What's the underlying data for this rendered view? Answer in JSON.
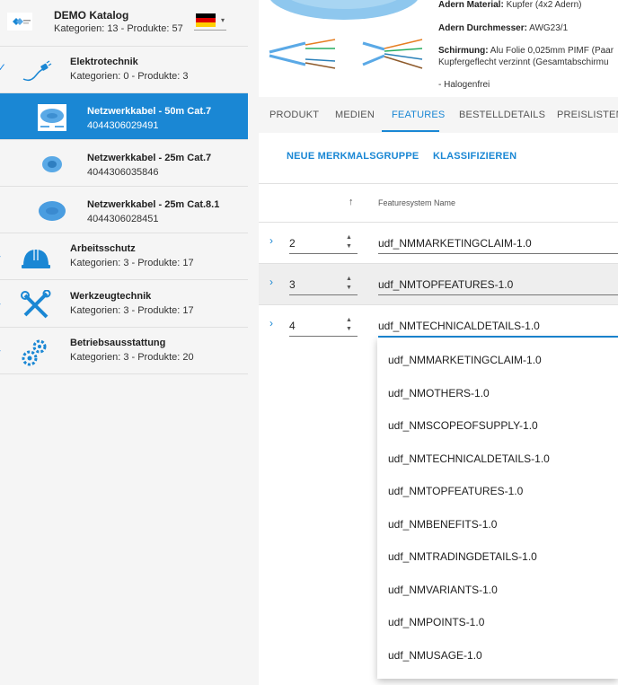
{
  "catalog": {
    "title": "DEMO Katalog",
    "meta": "Kategorien: 13 - Produkte: 57"
  },
  "tree": [
    {
      "title": "Elektrotechnik",
      "meta": "Kategorien: 0 - Produkte: 3"
    },
    {
      "title": "Arbeitsschutz",
      "meta": "Kategorien: 3 - Produkte: 17"
    },
    {
      "title": "Werkzeugtechnik",
      "meta": "Kategorien: 3 - Produkte: 17"
    },
    {
      "title": "Betriebsausstattung",
      "meta": "Kategorien: 3 - Produkte: 20"
    }
  ],
  "products": [
    {
      "title": "Netzwerkkabel - 50m Cat.7",
      "ean": "4044306029491"
    },
    {
      "title": "Netzwerkkabel - 25m Cat.7",
      "ean": "4044306035846"
    },
    {
      "title": "Netzwerkkabel - 25m Cat.8.1",
      "ean": "4044306028451"
    }
  ],
  "specs": {
    "adern_material_label": "Adern Material:",
    "adern_material_value": "Kupfer (4x2 Adern)",
    "adern_durchmesser_label": "Adern Durchmesser:",
    "adern_durchmesser_value": "AWG23/1",
    "schirmung_label": "Schirmung:",
    "schirmung_value": "Alu Folie 0,025mm PIMF (Paar",
    "schirmung_value_2": "Kupfergeflecht verzinnt (Gesamtabschirmu",
    "halogenfrei": "- Halogenfrei"
  },
  "tabs": [
    "PRODUKT",
    "MEDIEN",
    "FEATURES",
    "BESTELLDETAILS",
    "PREISLISTEN"
  ],
  "actions": {
    "new_group": "NEUE MERKMALSGRUPPE",
    "classify": "KLASSIFIZIEREN"
  },
  "table": {
    "sort_arrow": "↑",
    "col_name": "Featuresystem Name",
    "rows": [
      {
        "num": "2",
        "name": "udf_NMMARKETINGCLAIM-1.0"
      },
      {
        "num": "3",
        "name": "udf_NMTOPFEATURES-1.0"
      },
      {
        "num": "4",
        "name": "udf_NMTECHNICALDETAILS-1.0"
      }
    ]
  },
  "dropdown_options": [
    "udf_NMMARKETINGCLAIM-1.0",
    "udf_NMOTHERS-1.0",
    "udf_NMSCOPEOFSUPPLY-1.0",
    "udf_NMTECHNICALDETAILS-1.0",
    "udf_NMTOPFEATURES-1.0",
    "udf_NMBENEFITS-1.0",
    "udf_NMTRADINGDETAILS-1.0",
    "udf_NMVARIANTS-1.0",
    "udf_NMPOINTS-1.0",
    "udf_NMUSAGE-1.0"
  ],
  "colors": {
    "accent": "#1a87d4",
    "sidebar_bg": "#f5f5f5",
    "selected_bg": "#1a87d4"
  }
}
